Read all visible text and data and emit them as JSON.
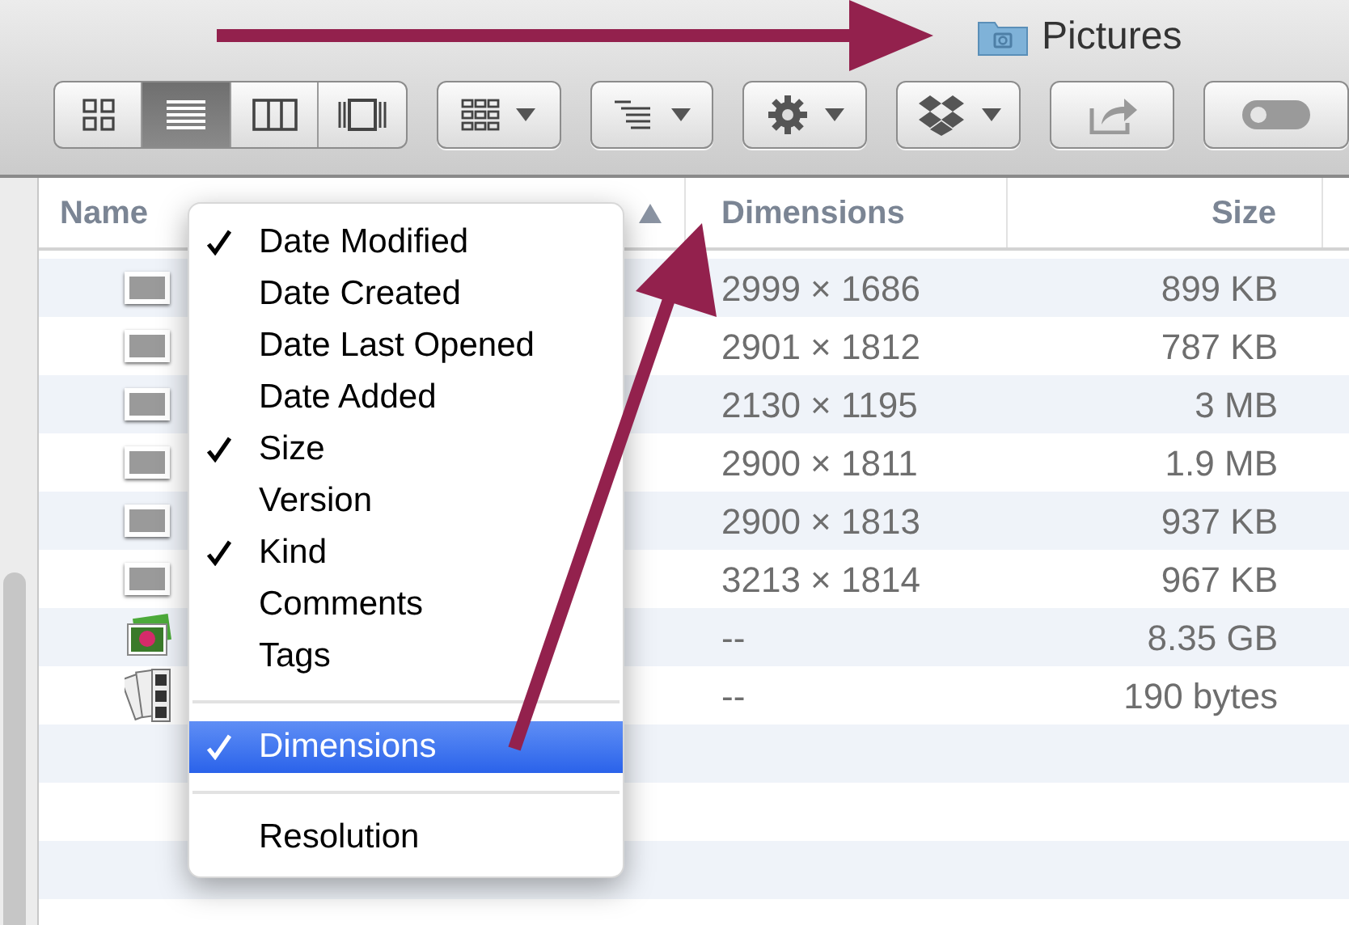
{
  "window": {
    "title": "Pictures"
  },
  "toolbar": {
    "view_modes": [
      {
        "kind": "icons",
        "selected": false
      },
      {
        "kind": "list",
        "selected": true
      },
      {
        "kind": "columns",
        "selected": false
      },
      {
        "kind": "coverflow",
        "selected": false
      }
    ],
    "buttons": [
      {
        "kind": "arrange"
      },
      {
        "kind": "sort"
      },
      {
        "kind": "action"
      },
      {
        "kind": "dropbox"
      },
      {
        "kind": "share"
      },
      {
        "kind": "tags"
      }
    ]
  },
  "table": {
    "columns": [
      {
        "label": "Name",
        "sorted": true
      },
      {
        "label": "Dimensions",
        "sorted": false
      },
      {
        "label": "Size",
        "sorted": false
      }
    ],
    "rows": [
      {
        "kind": "photo",
        "dimensions": "2999 × 1686",
        "size": "899 KB"
      },
      {
        "kind": "photo",
        "dimensions": "2901 × 1812",
        "size": "787 KB"
      },
      {
        "kind": "photo",
        "dimensions": "2130 × 1195",
        "size": "3 MB"
      },
      {
        "kind": "photo",
        "dimensions": "2900 × 1811",
        "size": "1.9 MB"
      },
      {
        "kind": "photo",
        "dimensions": "2900 × 1813",
        "size": "937 KB"
      },
      {
        "kind": "photo",
        "dimensions": "3213 × 1814",
        "size": "967 KB"
      },
      {
        "kind": "library",
        "dimensions": "--",
        "size": "8.35 GB"
      },
      {
        "kind": "booth",
        "dimensions": "--",
        "size": "190 bytes"
      }
    ]
  },
  "column_menu": {
    "items": [
      {
        "kind": "item",
        "label": "Date Modified",
        "checked": true,
        "selected": false
      },
      {
        "kind": "item",
        "label": "Date Created",
        "checked": false,
        "selected": false
      },
      {
        "kind": "item",
        "label": "Date Last Opened",
        "checked": false,
        "selected": false
      },
      {
        "kind": "item",
        "label": "Date Added",
        "checked": false,
        "selected": false
      },
      {
        "kind": "item",
        "label": "Size",
        "checked": true,
        "selected": false
      },
      {
        "kind": "item",
        "label": "Version",
        "checked": false,
        "selected": false
      },
      {
        "kind": "item",
        "label": "Kind",
        "checked": true,
        "selected": false
      },
      {
        "kind": "item",
        "label": "Comments",
        "checked": false,
        "selected": false
      },
      {
        "kind": "item",
        "label": "Tags",
        "checked": false,
        "selected": false
      },
      {
        "kind": "separator"
      },
      {
        "kind": "item",
        "label": "Dimensions",
        "checked": true,
        "selected": true
      },
      {
        "kind": "separator"
      },
      {
        "kind": "item",
        "label": "Resolution",
        "checked": false,
        "selected": false
      }
    ]
  }
}
